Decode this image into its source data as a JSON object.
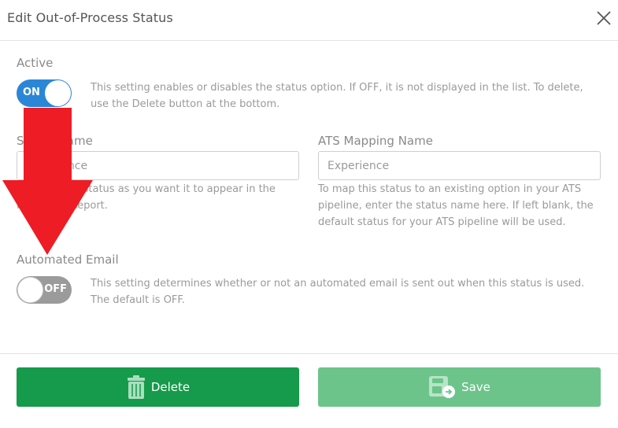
{
  "dialog": {
    "title": "Edit Out-of-Process Status"
  },
  "active": {
    "label": "Active",
    "toggle_state": "ON",
    "help": "This setting enables or disables the status option. If OFF, it is not displayed in the list. To delete, use the Delete button at the bottom."
  },
  "status_name": {
    "label": "Status Name",
    "value": "Experience",
    "help": "Name of the status as you want it to appear in the Hot Sheet Report."
  },
  "ats_mapping": {
    "label": "ATS Mapping Name",
    "placeholder": "Experience",
    "help": "To map this status to an existing option in your ATS pipeline, enter the status name here. If left blank, the default status for your ATS pipeline will be used."
  },
  "automated_email": {
    "label": "Automated Email",
    "toggle_state": "OFF",
    "help": "This setting determines whether or not an automated email is sent out when this status is used. The default is OFF."
  },
  "buttons": {
    "delete_label": "Delete",
    "save_label": "Save"
  },
  "colors": {
    "toggle_on": "#2b87d6",
    "toggle_off": "#9b9b9b",
    "delete_button": "#169a4b",
    "save_button": "#6cc48b",
    "annotation_arrow": "#ee1c25"
  },
  "icons": {
    "close": "close-icon",
    "delete": "trash-icon",
    "save": "save-icon",
    "annotation": "down-arrow-annotation"
  }
}
